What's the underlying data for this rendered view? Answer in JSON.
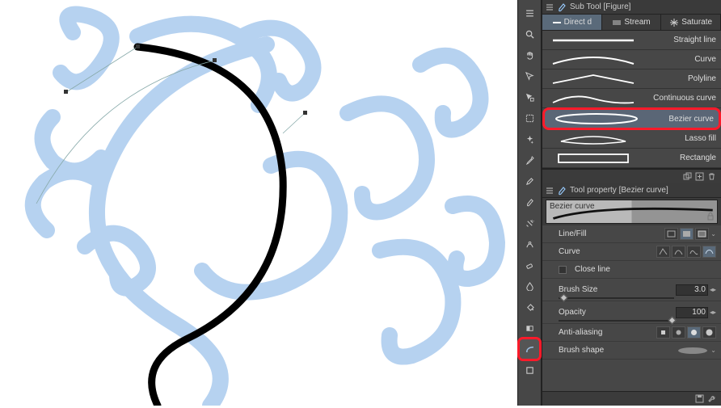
{
  "subtool_panel": {
    "title": "Sub Tool [Figure]",
    "tabs": [
      {
        "label": "Direct d",
        "active": true
      },
      {
        "label": "Stream",
        "active": false
      },
      {
        "label": "Saturate",
        "active": false
      }
    ],
    "items": [
      {
        "label": "Straight line"
      },
      {
        "label": "Curve"
      },
      {
        "label": "Polyline"
      },
      {
        "label": "Continuous curve"
      },
      {
        "label": "Bezier curve",
        "selected": true,
        "highlighted": true
      },
      {
        "label": "Lasso fill"
      },
      {
        "label": "Rectangle"
      }
    ]
  },
  "tool_property_panel": {
    "title": "Tool property [Bezier curve]",
    "preview_label": "Bezier curve",
    "rows": {
      "line_fill": "Line/Fill",
      "curve": "Curve",
      "close_line": "Close line",
      "brush_size_label": "Brush Size",
      "brush_size_value": "3.0",
      "opacity_label": "Opacity",
      "opacity_value": "100",
      "anti_alias": "Anti-aliasing",
      "brush_shape": "Brush shape"
    }
  },
  "tools": [
    "magnify",
    "hand",
    "move",
    "operation",
    "marquee",
    "auto-select",
    "wand",
    "eyedropper",
    "pen",
    "brush",
    "airbrush",
    "decoration",
    "eraser",
    "blend",
    "fill",
    "gradient",
    "figure",
    "frame"
  ],
  "highlighted_tool_index": 16,
  "colors": {
    "highlight": "#ff1a2a",
    "panel": "#3b3b3b",
    "stroke_blue": "#b6d2f0",
    "bezier_black": "#000"
  }
}
